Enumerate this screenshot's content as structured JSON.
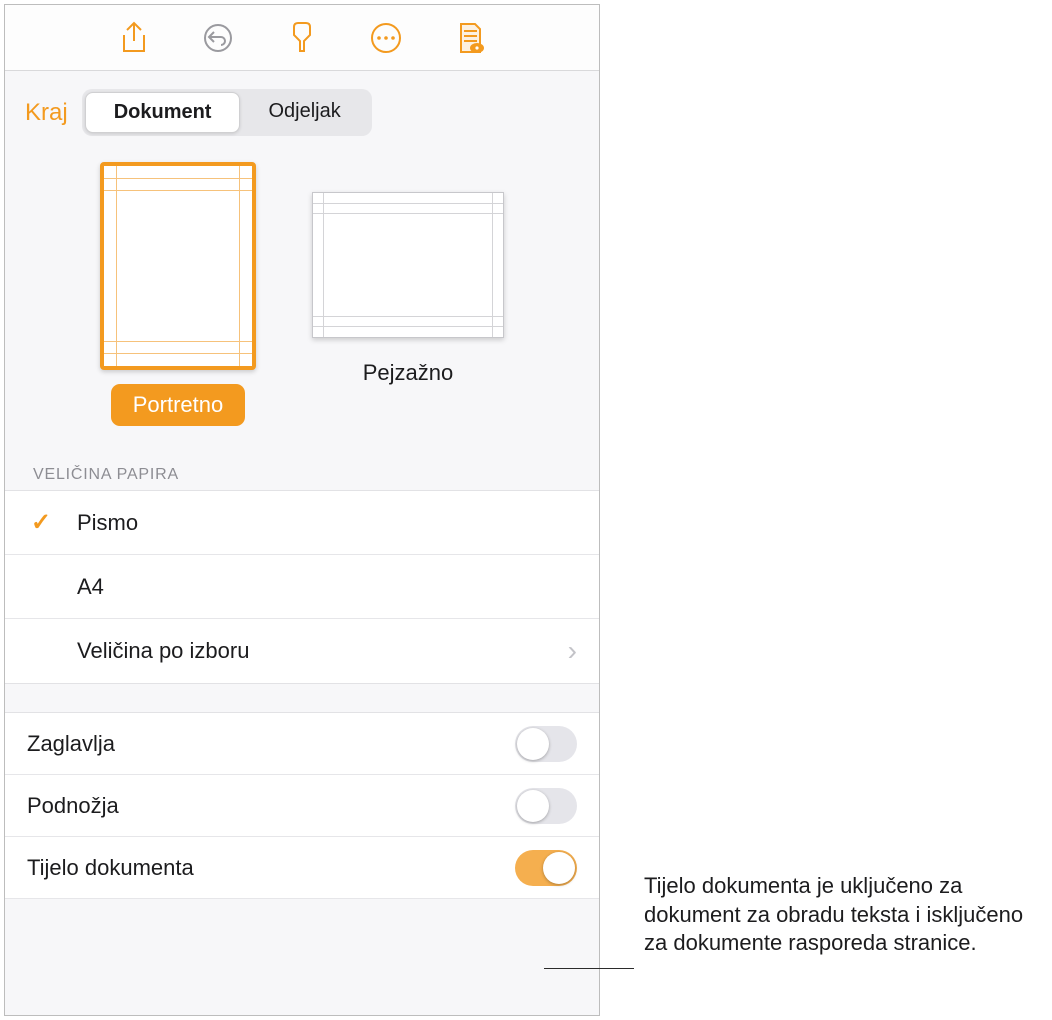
{
  "header": {
    "kraj_label": "Kraj",
    "tabs": {
      "dokument": "Dokument",
      "odjeljak": "Odjeljak"
    }
  },
  "orientation": {
    "portrait_label": "Portretno",
    "landscape_label": "Pejzažno"
  },
  "paper_size": {
    "header": "VELIČINA PAPIRA",
    "pismo": "Pismo",
    "a4": "A4",
    "custom": "Veličina po izboru"
  },
  "toggles": {
    "headers": "Zaglavlja",
    "footers": "Podnožja",
    "body": "Tijelo dokumenta"
  },
  "callout": "Tijelo dokumenta je uključeno za dokument za obradu teksta i isključeno za dokumente rasporeda stranice."
}
